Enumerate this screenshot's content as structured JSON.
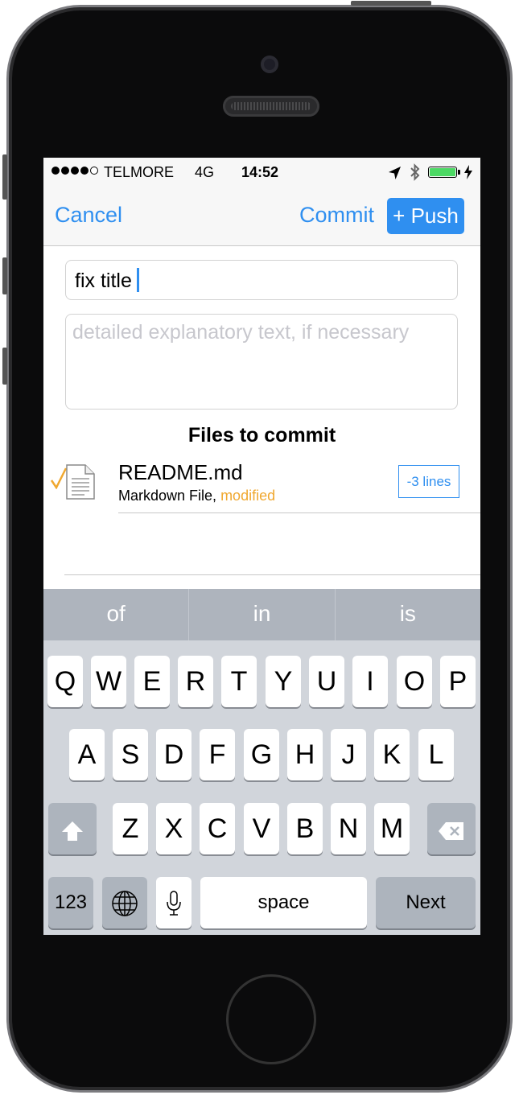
{
  "status_bar": {
    "signal_dots": 5,
    "signal_filled": 4,
    "carrier": "TELMORE",
    "network": "4G",
    "time": "14:52",
    "icons": [
      "location-arrow-icon",
      "bluetooth-icon",
      "battery-icon",
      "charging-bolt-icon"
    ],
    "battery_level": 1.0
  },
  "nav": {
    "cancel": "Cancel",
    "commit": "Commit",
    "push": "+ Push"
  },
  "form": {
    "title_value": "fix title",
    "description_placeholder": "detailed explanatory text, if necessary"
  },
  "files": {
    "heading": "Files to commit",
    "items": [
      {
        "name": "README.md",
        "type": "Markdown File,",
        "status": "modified",
        "badge": "-3 lines",
        "selected": true
      }
    ]
  },
  "suggestions": [
    "of",
    "in",
    "is"
  ],
  "keyboard": {
    "row1": [
      "Q",
      "W",
      "E",
      "R",
      "T",
      "Y",
      "U",
      "I",
      "O",
      "P"
    ],
    "row2": [
      "A",
      "S",
      "D",
      "F",
      "G",
      "H",
      "J",
      "K",
      "L"
    ],
    "row3": [
      "Z",
      "X",
      "C",
      "V",
      "B",
      "N",
      "M"
    ],
    "numbers": "123",
    "space": "space",
    "next": "Next",
    "icons": [
      "shift-icon",
      "backspace-icon",
      "globe-icon",
      "microphone-icon"
    ]
  },
  "colors": {
    "accent": "#2f8ff0",
    "modified": "#f0a830",
    "battery": "#4cd964"
  }
}
